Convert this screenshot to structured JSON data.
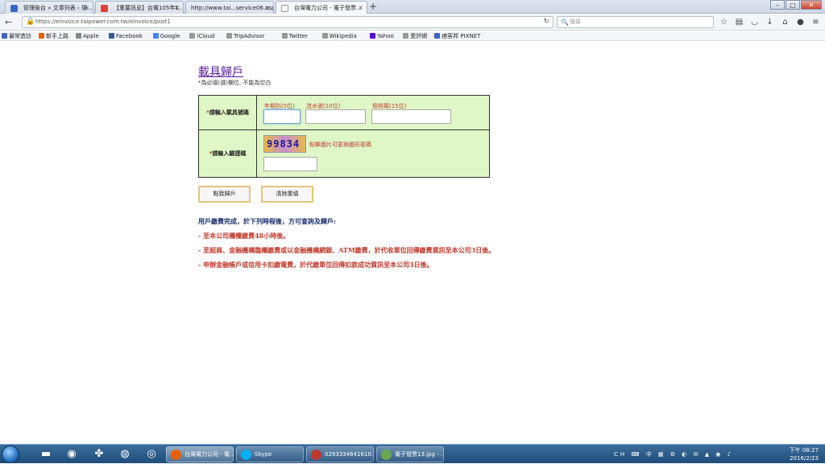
{
  "browser": {
    "tabs": [
      {
        "label": "管理後台 » 文章列表 ‹ 環...",
        "color": "#3a66c4"
      },
      {
        "label": "【重要訊息】台電105年1...",
        "color": "#d44638"
      },
      {
        "label": "http://www.tai...service06.aspx",
        "color": "#ffffff"
      },
      {
        "label": "台灣電力公司 - 電子發票...",
        "color": "#ffffff"
      }
    ],
    "new_tab": "+",
    "window_buttons": [
      "–",
      "□",
      "✕"
    ],
    "tab_close": "×",
    "url": "https://einvoice.taipower.com.tw/einvoice/post1",
    "search_placeholder": "搜尋",
    "bookmarks": [
      {
        "label": "最常造訪",
        "color": "#3a66c4"
      },
      {
        "label": "新手上路",
        "color": "#e66000"
      },
      {
        "label": "Apple",
        "color": "#888888"
      },
      {
        "label": "Facebook",
        "color": "#3b5998"
      },
      {
        "label": "Google",
        "color": "#4285f4"
      },
      {
        "label": "iCloud",
        "color": "#999999"
      },
      {
        "label": "TripAdvisor",
        "color": "#999999"
      },
      {
        "label": "Twitter",
        "color": "#999999"
      },
      {
        "label": "Wikipedia",
        "color": "#999999"
      },
      {
        "label": "Yahoo",
        "color": "#5f01d1"
      },
      {
        "label": "愛評網",
        "color": "#999999"
      },
      {
        "label": "痞客邦 PIXNET",
        "color": "#3a66c4"
      }
    ]
  },
  "page": {
    "title": "載具歸戶",
    "subtitle": "*為必填(選)欄位, 不能為空白",
    "form": {
      "row1_label_star": "*",
      "row1_label": "請輸入載具號碼",
      "fields": [
        {
          "label": "年期別(5位)"
        },
        {
          "label": "流水號(10位)"
        },
        {
          "label": "檢核碼(15位)"
        }
      ],
      "row2_label_star": "*",
      "row2_label": "請輸入驗證碼",
      "captcha_text": "99834",
      "captcha_note": "點擊圖片可更換圖形密碼"
    },
    "buttons": {
      "submit": "點我歸戶",
      "reset": "清除重填"
    },
    "notes": {
      "heading": "用戶繳費完成，於下列時程後，方可查詢及歸戶:",
      "items": [
        "- 至本公司櫃檯繳費48小時後。",
        "- 至超商、金融機構臨櫃繳費或以金融機構網銀、ATM繳費，於代收單位回傳繳費資訊至本公司3日後。",
        "- 申辦金融帳戶或信用卡扣繳電費，於代繳單位回傳扣款成功資訊至本公司3日後。"
      ]
    }
  },
  "taskbar": {
    "tasks": [
      {
        "label": "台灣電力公司 - 電...",
        "color": "#e66000"
      },
      {
        "label": "Skype",
        "color": "#00aff0"
      },
      {
        "label": "0293334641610...",
        "color": "#c0392b"
      },
      {
        "label": "電子發票13.jpg - ...",
        "color": "#6aa84f"
      }
    ],
    "tray": "CH ⌨ 中 ▦ ⚙ ◐ ✉ ▲ ◉ ♪",
    "clock_time": "下午 08:27",
    "clock_date": "2016/2/23"
  }
}
